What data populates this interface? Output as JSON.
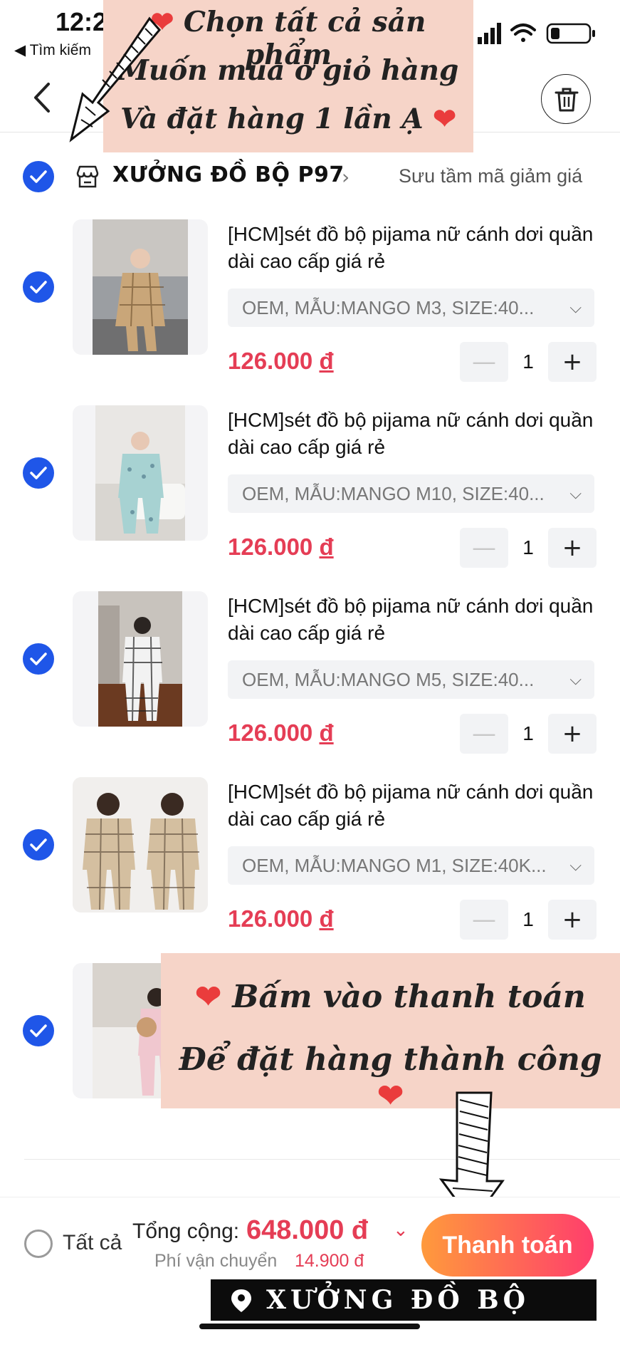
{
  "status_bar": {
    "time": "12:2",
    "back_app": "◀ Tìm kiếm"
  },
  "shop": {
    "name": "XƯỞNG ĐỒ BỘ P97",
    "chevron": "›",
    "voucher_link": "Sưu tầm mã giảm giá"
  },
  "items": [
    {
      "title": "[HCM]sét đồ bộ pijama nữ cánh dơi quần dài cao cấp giá rẻ",
      "variant": "OEM, MẪU:MANGO M3, SIZE:40...",
      "price": "126.000",
      "currency": "đ",
      "quantity": "1",
      "checked": true
    },
    {
      "title": "[HCM]sét đồ bộ pijama nữ cánh dơi quần dài cao cấp giá rẻ",
      "variant": "OEM, MẪU:MANGO M10, SIZE:40...",
      "price": "126.000",
      "currency": "đ",
      "quantity": "1",
      "checked": true
    },
    {
      "title": "[HCM]sét đồ bộ pijama nữ cánh dơi quần dài cao cấp giá rẻ",
      "variant": "OEM, MẪU:MANGO M5, SIZE:40...",
      "price": "126.000",
      "currency": "đ",
      "quantity": "1",
      "checked": true
    },
    {
      "title": "[HCM]sét đồ bộ pijama nữ cánh dơi quần dài cao cấp giá rẻ",
      "variant": "OEM, MẪU:MANGO M1, SIZE:40K...",
      "price": "126.000",
      "currency": "đ",
      "quantity": "1",
      "checked": true
    },
    {
      "title": "",
      "variant": "",
      "price": "",
      "currency": "",
      "quantity": "",
      "checked": true
    }
  ],
  "footer": {
    "select_all_label": "Tất cả",
    "total_label": "Tổng cộng:",
    "total_value": "648.000 đ",
    "shipping_label": "Phí vận chuyển",
    "shipping_value": "14.900 đ",
    "checkout_label": "Thanh toán"
  },
  "overlay_top": {
    "line1": "Chọn tất cả sản phẩm",
    "line2": "Muốn mua ở giỏ hàng",
    "line3": "Và đặt hàng 1 lần Ạ"
  },
  "overlay_bottom": {
    "line1": "Bấm vào thanh toán",
    "line2": "Để đặt hàng thành công"
  },
  "shop_tag": "XƯỞNG ĐỒ BỘ P97",
  "colors": {
    "accent_blue": "#1f56e8",
    "price_red": "#e53d55",
    "overlay_peach": "#f6d4c8",
    "checkout_gradient_start": "#ff9a3c",
    "checkout_gradient_end": "#ff3e6c"
  },
  "icons": [
    "back-chevron-icon",
    "trash-icon",
    "store-icon",
    "check-icon",
    "chevron-down-icon",
    "minus-icon",
    "plus-icon",
    "signal-icon",
    "wifi-icon",
    "battery-icon",
    "heart-icon",
    "arrow-icon",
    "location-pin-icon"
  ]
}
